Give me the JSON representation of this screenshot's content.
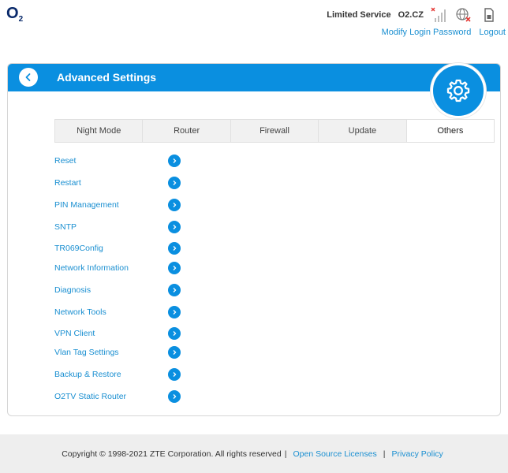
{
  "header": {
    "logo": "O",
    "logo_sub": "2",
    "status_text": "Limited Service",
    "operator": "O2.CZ",
    "links": {
      "modify_password": "Modify Login Password",
      "logout": "Logout"
    }
  },
  "panel": {
    "title": "Advanced Settings"
  },
  "tabs": [
    {
      "label": "Night Mode",
      "active": false
    },
    {
      "label": "Router",
      "active": false
    },
    {
      "label": "Firewall",
      "active": false
    },
    {
      "label": "Update",
      "active": false
    },
    {
      "label": "Others",
      "active": true
    }
  ],
  "menu": [
    {
      "label": "Reset"
    },
    {
      "label": "Restart"
    },
    {
      "label": "PIN Management"
    },
    {
      "label": "SNTP"
    },
    {
      "label": "TR069Config"
    },
    {
      "label": "Network Information"
    },
    {
      "label": "Diagnosis"
    },
    {
      "label": "Network Tools"
    },
    {
      "label": "VPN Client"
    },
    {
      "label": "Vlan Tag Settings"
    },
    {
      "label": "Backup & Restore"
    },
    {
      "label": "O2TV Static Router"
    }
  ],
  "footer": {
    "copyright": "Copyright © 1998-2021 ZTE Corporation. All rights reserved",
    "sep": "|",
    "open_source": "Open Source Licenses",
    "privacy": "Privacy Policy"
  },
  "colors": {
    "accent": "#0a8fe0",
    "link": "#1a8fd1",
    "error": "#e53935"
  },
  "icons": [
    "back-icon",
    "gear-icon",
    "signal-icon",
    "globe-icon",
    "sim-icon",
    "chevron-right-icon"
  ]
}
